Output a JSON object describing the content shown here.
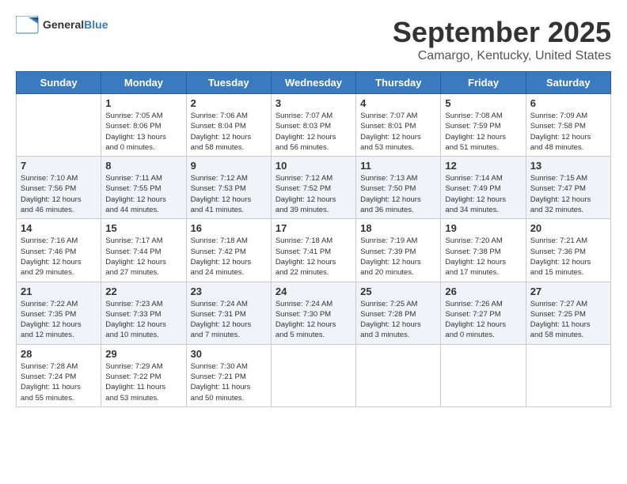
{
  "header": {
    "logo_general": "General",
    "logo_blue": "Blue",
    "month": "September 2025",
    "location": "Camargo, Kentucky, United States"
  },
  "days_of_week": [
    "Sunday",
    "Monday",
    "Tuesday",
    "Wednesday",
    "Thursday",
    "Friday",
    "Saturday"
  ],
  "weeks": [
    [
      {
        "day": "",
        "content": ""
      },
      {
        "day": "1",
        "content": "Sunrise: 7:05 AM\nSunset: 8:06 PM\nDaylight: 13 hours\nand 0 minutes."
      },
      {
        "day": "2",
        "content": "Sunrise: 7:06 AM\nSunset: 8:04 PM\nDaylight: 12 hours\nand 58 minutes."
      },
      {
        "day": "3",
        "content": "Sunrise: 7:07 AM\nSunset: 8:03 PM\nDaylight: 12 hours\nand 56 minutes."
      },
      {
        "day": "4",
        "content": "Sunrise: 7:07 AM\nSunset: 8:01 PM\nDaylight: 12 hours\nand 53 minutes."
      },
      {
        "day": "5",
        "content": "Sunrise: 7:08 AM\nSunset: 7:59 PM\nDaylight: 12 hours\nand 51 minutes."
      },
      {
        "day": "6",
        "content": "Sunrise: 7:09 AM\nSunset: 7:58 PM\nDaylight: 12 hours\nand 48 minutes."
      }
    ],
    [
      {
        "day": "7",
        "content": "Sunrise: 7:10 AM\nSunset: 7:56 PM\nDaylight: 12 hours\nand 46 minutes."
      },
      {
        "day": "8",
        "content": "Sunrise: 7:11 AM\nSunset: 7:55 PM\nDaylight: 12 hours\nand 44 minutes."
      },
      {
        "day": "9",
        "content": "Sunrise: 7:12 AM\nSunset: 7:53 PM\nDaylight: 12 hours\nand 41 minutes."
      },
      {
        "day": "10",
        "content": "Sunrise: 7:12 AM\nSunset: 7:52 PM\nDaylight: 12 hours\nand 39 minutes."
      },
      {
        "day": "11",
        "content": "Sunrise: 7:13 AM\nSunset: 7:50 PM\nDaylight: 12 hours\nand 36 minutes."
      },
      {
        "day": "12",
        "content": "Sunrise: 7:14 AM\nSunset: 7:49 PM\nDaylight: 12 hours\nand 34 minutes."
      },
      {
        "day": "13",
        "content": "Sunrise: 7:15 AM\nSunset: 7:47 PM\nDaylight: 12 hours\nand 32 minutes."
      }
    ],
    [
      {
        "day": "14",
        "content": "Sunrise: 7:16 AM\nSunset: 7:46 PM\nDaylight: 12 hours\nand 29 minutes."
      },
      {
        "day": "15",
        "content": "Sunrise: 7:17 AM\nSunset: 7:44 PM\nDaylight: 12 hours\nand 27 minutes."
      },
      {
        "day": "16",
        "content": "Sunrise: 7:18 AM\nSunset: 7:42 PM\nDaylight: 12 hours\nand 24 minutes."
      },
      {
        "day": "17",
        "content": "Sunrise: 7:18 AM\nSunset: 7:41 PM\nDaylight: 12 hours\nand 22 minutes."
      },
      {
        "day": "18",
        "content": "Sunrise: 7:19 AM\nSunset: 7:39 PM\nDaylight: 12 hours\nand 20 minutes."
      },
      {
        "day": "19",
        "content": "Sunrise: 7:20 AM\nSunset: 7:38 PM\nDaylight: 12 hours\nand 17 minutes."
      },
      {
        "day": "20",
        "content": "Sunrise: 7:21 AM\nSunset: 7:36 PM\nDaylight: 12 hours\nand 15 minutes."
      }
    ],
    [
      {
        "day": "21",
        "content": "Sunrise: 7:22 AM\nSunset: 7:35 PM\nDaylight: 12 hours\nand 12 minutes."
      },
      {
        "day": "22",
        "content": "Sunrise: 7:23 AM\nSunset: 7:33 PM\nDaylight: 12 hours\nand 10 minutes."
      },
      {
        "day": "23",
        "content": "Sunrise: 7:24 AM\nSunset: 7:31 PM\nDaylight: 12 hours\nand 7 minutes."
      },
      {
        "day": "24",
        "content": "Sunrise: 7:24 AM\nSunset: 7:30 PM\nDaylight: 12 hours\nand 5 minutes."
      },
      {
        "day": "25",
        "content": "Sunrise: 7:25 AM\nSunset: 7:28 PM\nDaylight: 12 hours\nand 3 minutes."
      },
      {
        "day": "26",
        "content": "Sunrise: 7:26 AM\nSunset: 7:27 PM\nDaylight: 12 hours\nand 0 minutes."
      },
      {
        "day": "27",
        "content": "Sunrise: 7:27 AM\nSunset: 7:25 PM\nDaylight: 11 hours\nand 58 minutes."
      }
    ],
    [
      {
        "day": "28",
        "content": "Sunrise: 7:28 AM\nSunset: 7:24 PM\nDaylight: 11 hours\nand 55 minutes."
      },
      {
        "day": "29",
        "content": "Sunrise: 7:29 AM\nSunset: 7:22 PM\nDaylight: 11 hours\nand 53 minutes."
      },
      {
        "day": "30",
        "content": "Sunrise: 7:30 AM\nSunset: 7:21 PM\nDaylight: 11 hours\nand 50 minutes."
      },
      {
        "day": "",
        "content": ""
      },
      {
        "day": "",
        "content": ""
      },
      {
        "day": "",
        "content": ""
      },
      {
        "day": "",
        "content": ""
      }
    ]
  ]
}
